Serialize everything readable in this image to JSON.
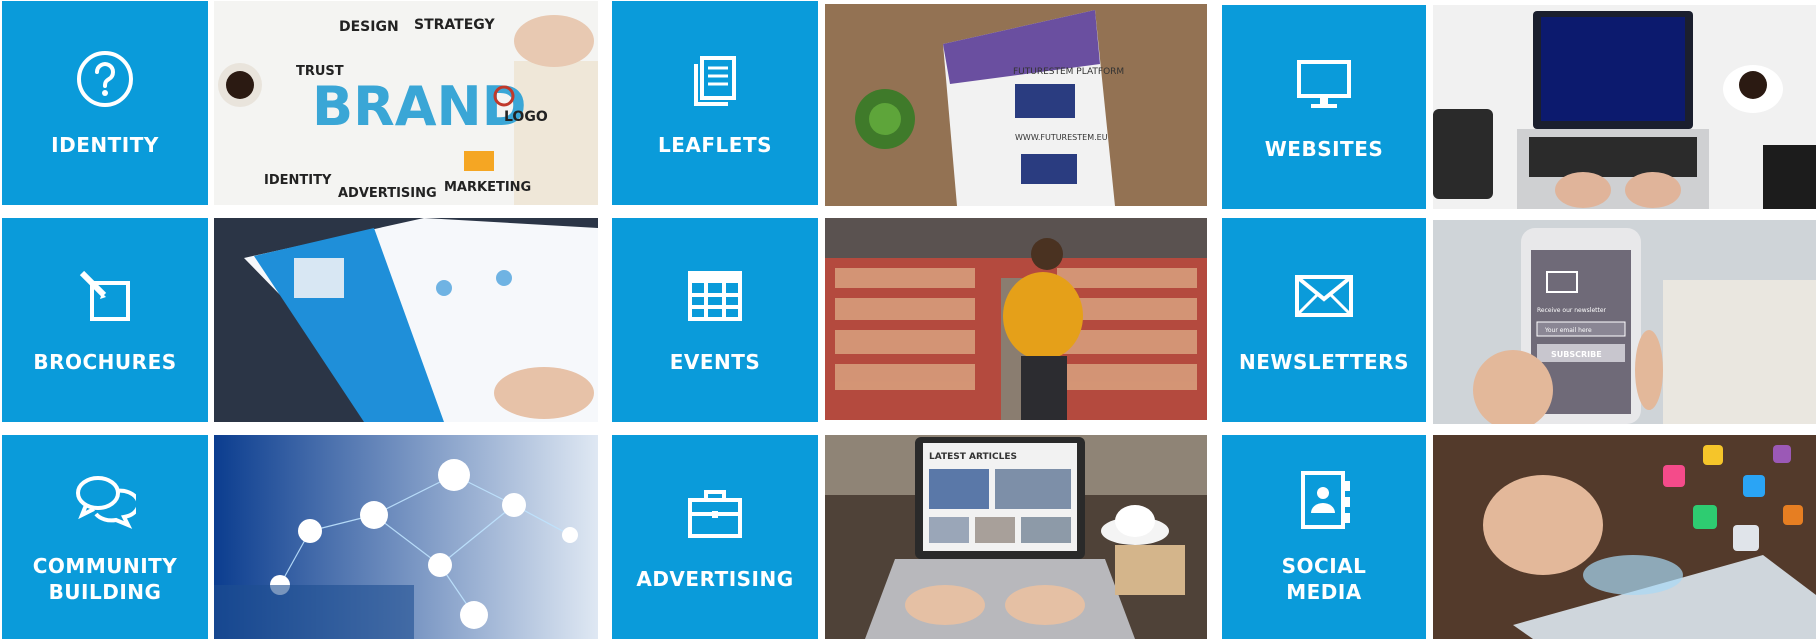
{
  "tiles": {
    "identity": {
      "label": "IDENTITY",
      "icon": "question-circle-icon"
    },
    "leaflets": {
      "label": "LEAFLETS",
      "icon": "documents-icon"
    },
    "websites": {
      "label": "WEBSITES",
      "icon": "monitor-icon"
    },
    "brochures": {
      "label": "BROCHURES",
      "icon": "edit-pencil-icon"
    },
    "events": {
      "label": "EVENTS",
      "icon": "table-grid-icon"
    },
    "newsletters": {
      "label": "NEWSLETTERS",
      "icon": "envelope-icon"
    },
    "community": {
      "label": "COMMUNITY\nBUILDING",
      "icon": "chat-bubbles-icon"
    },
    "advertising": {
      "label": "ADVERTISING",
      "icon": "briefcase-icon"
    },
    "social": {
      "label": "SOCIAL\nMEDIA",
      "icon": "contact-book-icon"
    }
  },
  "photos": {
    "brand": {
      "center": "BRAND",
      "words": [
        "DESIGN",
        "STRATEGY",
        "TRUST",
        "LOGO",
        "IDENTITY",
        "ADVERTISING",
        "MARKETING"
      ]
    },
    "leaflet": {
      "title": "FUTURESTEM PLATFORM",
      "url": "WWW.FUTURESTEM.EU"
    },
    "laptop_articles": {
      "heading": "LATEST ARTICLES"
    },
    "phone_newsletter": {
      "line": "Receive our newsletter",
      "placeholder": "Your email here",
      "button": "SUBSCRIBE"
    }
  },
  "colors": {
    "tile_blue": "#0a9bda"
  }
}
